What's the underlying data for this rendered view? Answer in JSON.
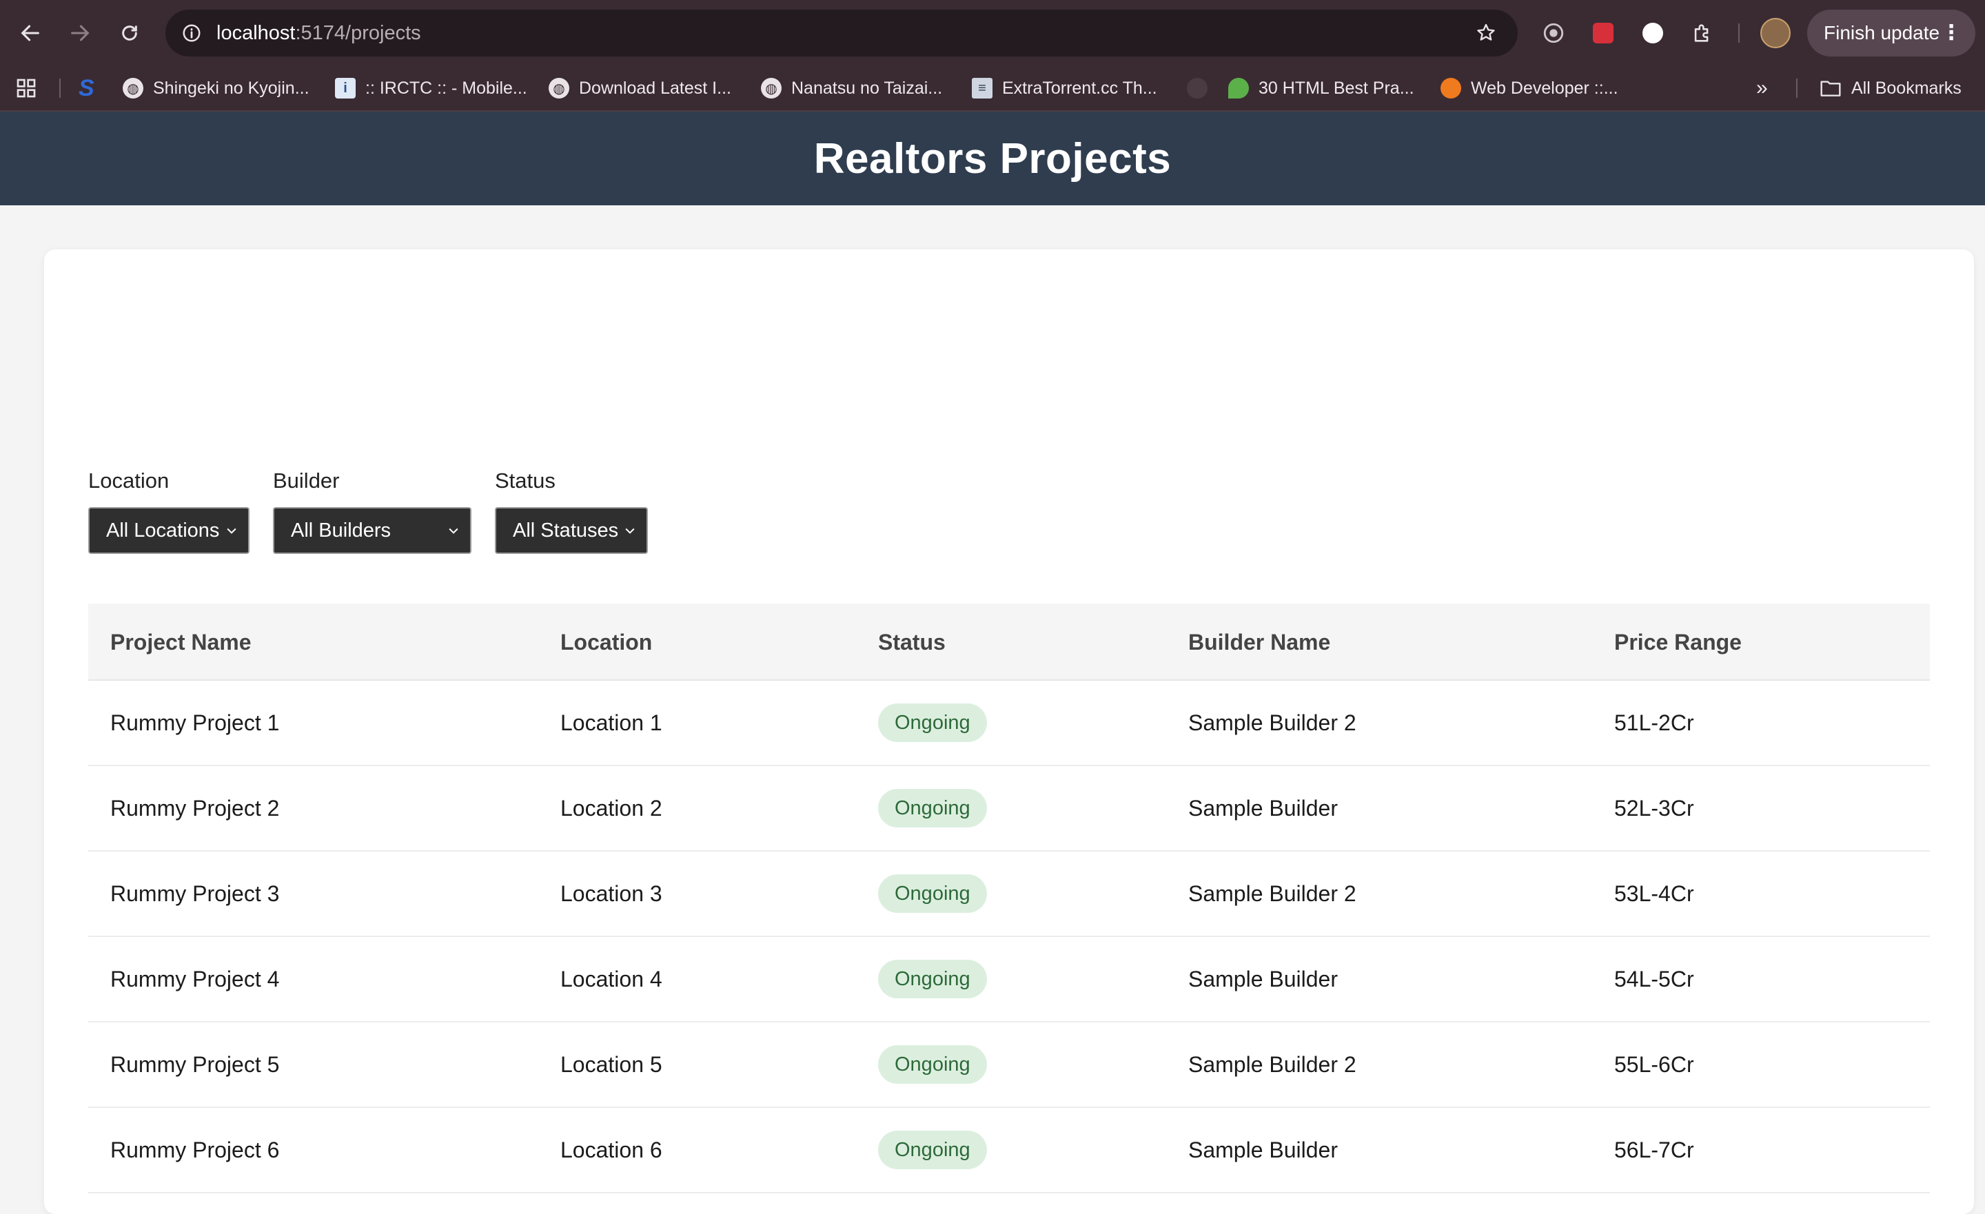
{
  "browser": {
    "url_host": "localhost",
    "url_path": ":5174/projects",
    "finish_update_label": "Finish update",
    "bookmarks": [
      {
        "label": "Shingeki no Kyojin..."
      },
      {
        "label": ":: IRCTC :: - Mobile..."
      },
      {
        "label": "Download Latest I..."
      },
      {
        "label": "Nanatsu no Taizai..."
      },
      {
        "label": "ExtraTorrent.cc Th..."
      },
      {
        "label": "30 HTML Best Pra..."
      },
      {
        "label": "Web Developer ::..."
      }
    ],
    "all_bookmarks_label": "All Bookmarks",
    "overflow_label": "»"
  },
  "page": {
    "title": "Realtors Projects"
  },
  "filters": {
    "location": {
      "label": "Location",
      "value": "All Locations"
    },
    "builder": {
      "label": "Builder",
      "value": "All Builders"
    },
    "status": {
      "label": "Status",
      "value": "All Statuses"
    }
  },
  "table": {
    "headers": [
      "Project Name",
      "Location",
      "Status",
      "Builder Name",
      "Price Range"
    ],
    "rows": [
      {
        "name": "Rummy Project 1",
        "location": "Location 1",
        "status": "Ongoing",
        "builder": "Sample Builder 2",
        "price": "51L-2Cr"
      },
      {
        "name": "Rummy Project 2",
        "location": "Location 2",
        "status": "Ongoing",
        "builder": "Sample Builder",
        "price": "52L-3Cr"
      },
      {
        "name": "Rummy Project 3",
        "location": "Location 3",
        "status": "Ongoing",
        "builder": "Sample Builder 2",
        "price": "53L-4Cr"
      },
      {
        "name": "Rummy Project 4",
        "location": "Location 4",
        "status": "Ongoing",
        "builder": "Sample Builder",
        "price": "54L-5Cr"
      },
      {
        "name": "Rummy Project 5",
        "location": "Location 5",
        "status": "Ongoing",
        "builder": "Sample Builder 2",
        "price": "55L-6Cr"
      },
      {
        "name": "Rummy Project 6",
        "location": "Location 6",
        "status": "Ongoing",
        "builder": "Sample Builder",
        "price": "56L-7Cr"
      }
    ]
  },
  "colors": {
    "header_bg": "#2f3d4f",
    "badge_bg": "#dcefdf",
    "badge_text": "#2e6a3a",
    "select_bg": "#2f2f2f"
  }
}
